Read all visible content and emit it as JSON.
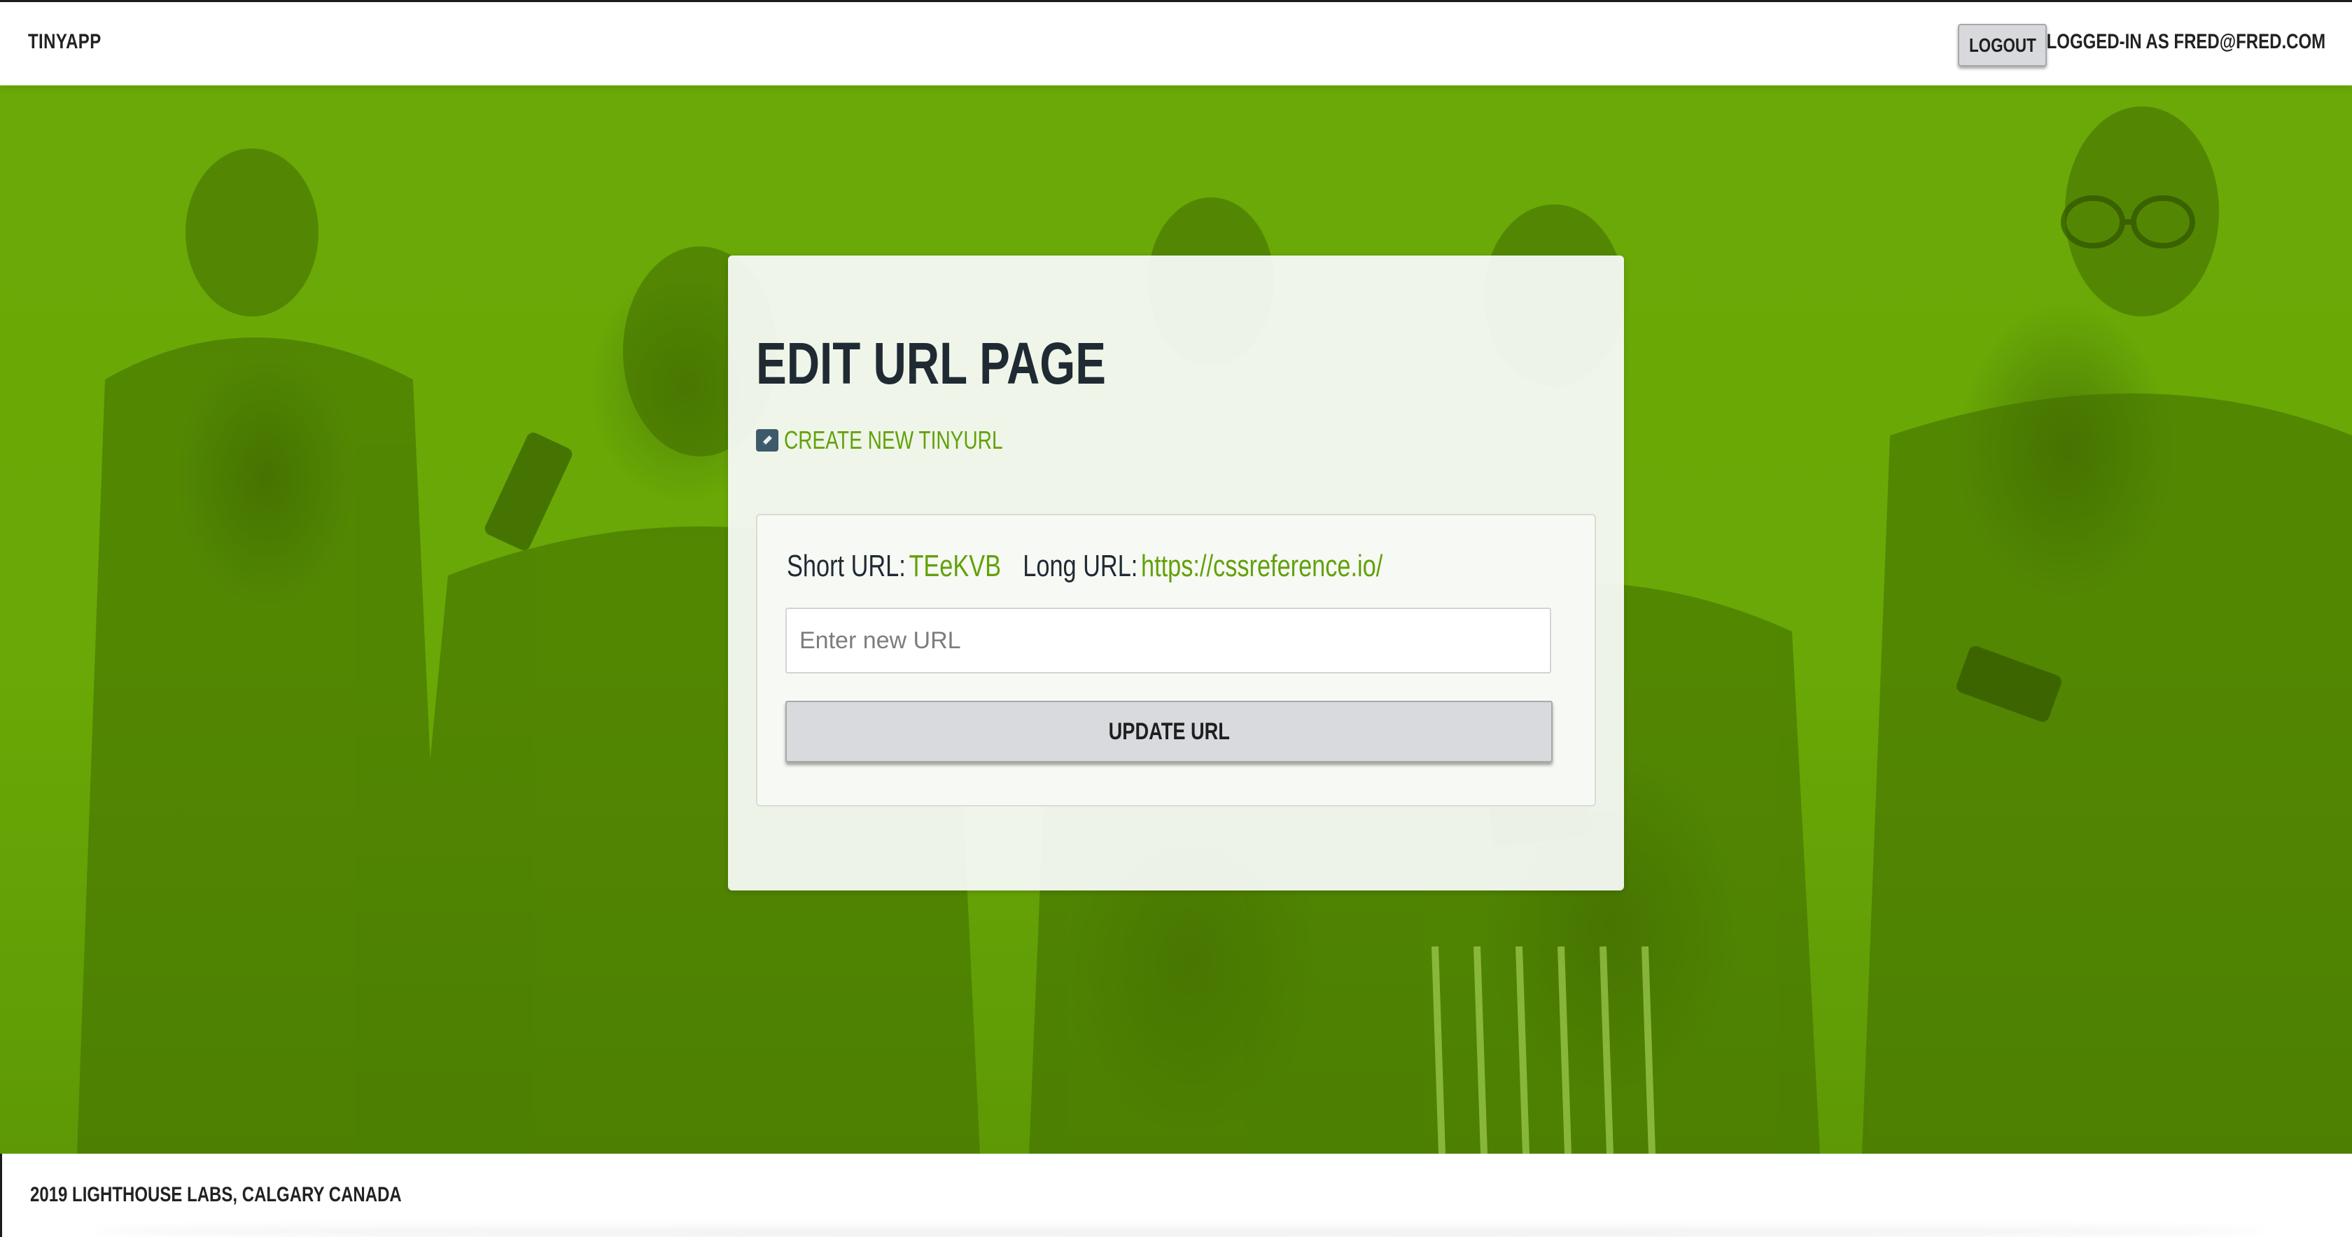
{
  "header": {
    "brand": "TINYAPP",
    "logout_label": "LOGOUT",
    "logged_in_text": "LOGGED-IN AS FRED@FRED.COM"
  },
  "card": {
    "title": "EDIT URL PAGE",
    "create_link_label": "CREATE NEW TINYURL",
    "create_link_icon": "edit-icon",
    "short_url_label": "Short URL:",
    "short_url_value": "TEeKVB",
    "long_url_label": "Long URL:",
    "long_url_value": "https://cssreference.io/",
    "input_placeholder": "Enter new URL",
    "input_value": "",
    "update_label": "UPDATE URL"
  },
  "footer": {
    "text": "2019 LIGHTHOUSE LABS, CALGARY CANADA"
  },
  "colors": {
    "accent_green": "#62a10a",
    "hero_green": "#6aa907",
    "heading_dark": "#1f2a33",
    "button_gray": "#d8dadd"
  }
}
